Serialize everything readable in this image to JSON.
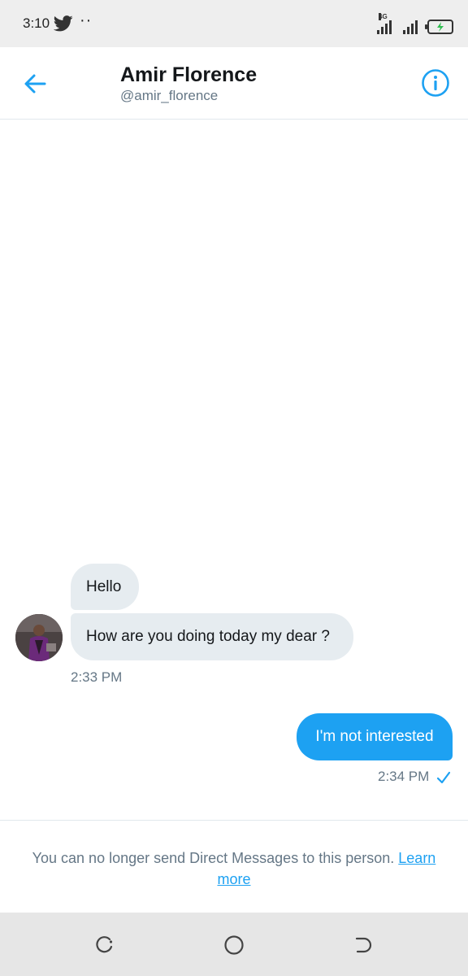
{
  "status_bar": {
    "time": "3:10",
    "network_label": "4G",
    "icons": [
      "twitter-icon",
      "notification-dots-icon",
      "signal-icon",
      "battery-charging-icon"
    ]
  },
  "header": {
    "name": "Amir Florence",
    "handle": "@amir_florence",
    "back_icon": "arrow-left-icon",
    "info_icon": "info-circle-icon"
  },
  "conversation": {
    "incoming": [
      {
        "text": "Hello"
      },
      {
        "text": "How are you doing today my dear ?"
      }
    ],
    "incoming_time": "2:33 PM",
    "outgoing": [
      {
        "text": "I'm not interested"
      }
    ],
    "outgoing_time": "2:34 PM"
  },
  "notice": {
    "text": "You can no longer send Direct Messages to this person.",
    "link_line1": "Learn",
    "link_line2": "more"
  },
  "nav_bar": {
    "icons": [
      "recent-apps-icon",
      "home-icon",
      "back-icon"
    ]
  },
  "colors": {
    "accent": "#1da1f2",
    "bubble_in": "#e6ecf0",
    "secondary_text": "#657786"
  }
}
